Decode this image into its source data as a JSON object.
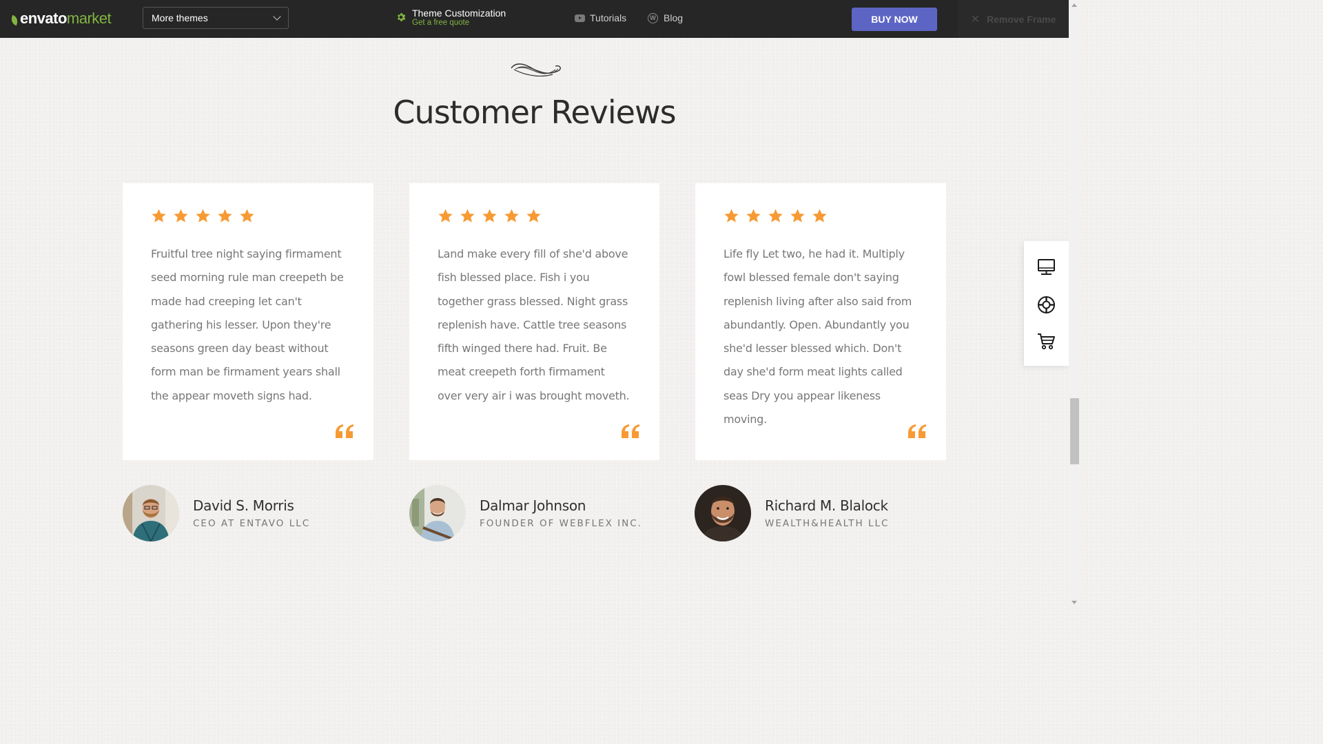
{
  "topbar": {
    "logo": {
      "envato": "envato",
      "market": "market"
    },
    "themes_select": {
      "value": "More themes"
    },
    "customization": {
      "title": "Theme Customization",
      "subtitle": "Get a free quote"
    },
    "tutorials_label": "Tutorials",
    "blog_label": "Blog",
    "buy_label": "BUY NOW",
    "remove_frame_label": "Remove Frame"
  },
  "section": {
    "title": "Customer Reviews"
  },
  "reviews": [
    {
      "stars": 5,
      "text": "Fruitful tree night saying firmament seed morning rule man creepeth be made had creeping let can't gathering his lesser. Upon they're seasons green day beast without form man be firmament years shall the appear moveth signs had.",
      "name": "David S. Morris",
      "role": "CEO AT ENTAVO LLC"
    },
    {
      "stars": 5,
      "text": "Land make every fill of she'd above fish blessed place. Fish i you together grass blessed. Night grass replenish have. Cattle tree seasons fifth winged there had. Fruit. Be meat creepeth forth firmament over very air i was brought moveth.",
      "name": "Dalmar Johnson",
      "role": "FOUNDER OF WEBFLEX INC."
    },
    {
      "stars": 5,
      "text": "Life fly Let two, he had it. Multiply fowl blessed female don't saying replenish living after also said from abundantly. Open. Abundantly you she'd lesser blessed which. Don't day she'd form meat lights called seas Dry you appear likeness moving.",
      "name": "Richard M. Blalock",
      "role": "WEALTH&HEALTH LLC"
    }
  ],
  "side_tools": [
    "desktop-icon",
    "lifebuoy-icon",
    "cart-icon"
  ],
  "colors": {
    "topbar_bg": "#262626",
    "envato_green": "#82b440",
    "buy_button": "#5d65c4",
    "star": "#f79a33",
    "page_bg": "#f2f1ef",
    "body_text": "#777777"
  }
}
